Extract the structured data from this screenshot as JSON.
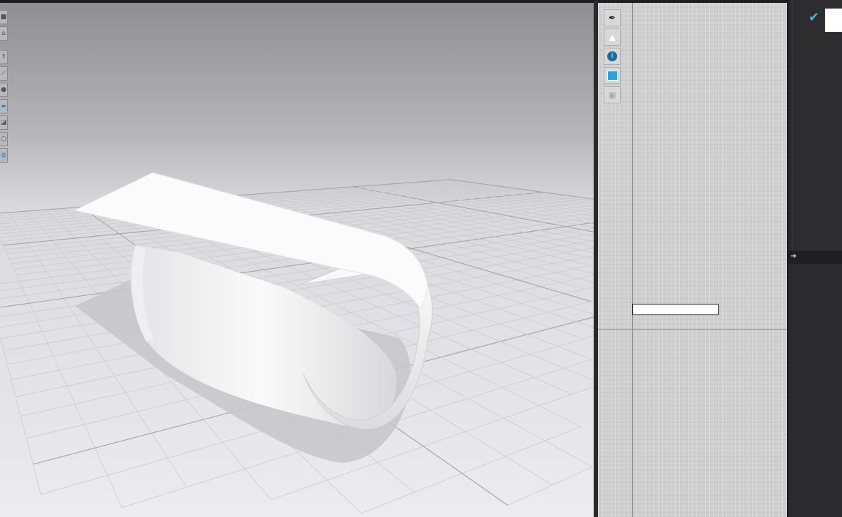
{
  "viewport": {
    "toolbar_icons": [
      "box-view-icon",
      "shirt-outline-icon",
      "shirt-icon",
      "shirt-edit-icon",
      "avatar-icon",
      "fabric-blue-icon",
      "fabric-dark-icon",
      "avatar-ghost-icon",
      "globe-icon"
    ],
    "colors": {
      "top": "#8f8f93",
      "floor": "#ececf0",
      "grid": "#c8c8cc",
      "model": "#f7f7f7",
      "shadow": "#c4c4c8"
    }
  },
  "pattern_panel": {
    "toolbar_icons": [
      "needle-visibility-icon",
      "garment-visibility-icon",
      "info-visibility-icon",
      "fabric-icon",
      "lock-garment-icon"
    ],
    "colors": {
      "background": "#cfcfcf",
      "pattern_piece": "#ffffff"
    }
  },
  "side_panel": {
    "icons": [
      "checkmark-icon",
      "expand-arrow-icon"
    ],
    "colors": {
      "background": "#2b2b2e",
      "accent": "#3fb6e8"
    }
  }
}
